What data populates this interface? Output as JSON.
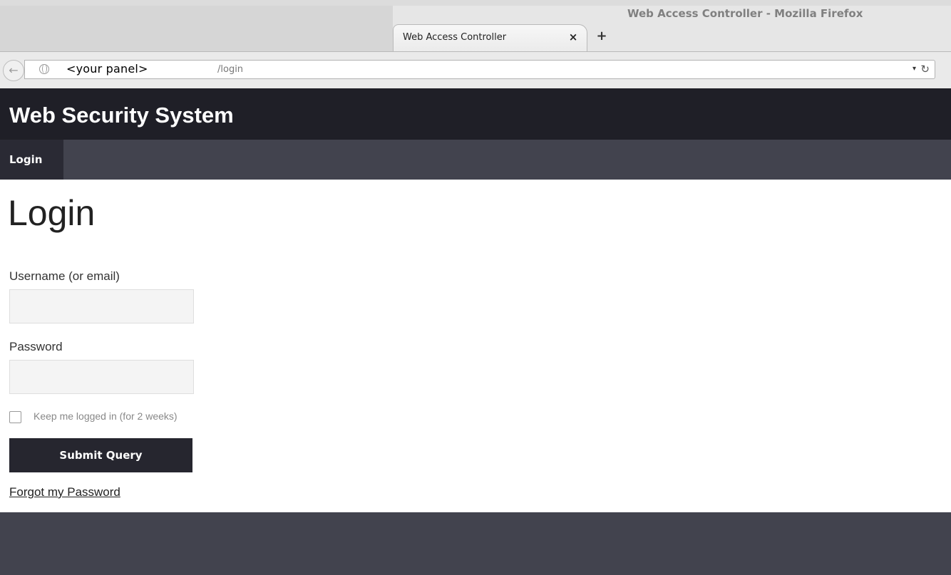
{
  "browser": {
    "window_title": "Web Access Controller - Mozilla Firefox",
    "tab_title": "Web Access Controller",
    "tab_close_icon": "×",
    "new_tab_icon": "+",
    "back_icon": "←",
    "url_host": "<your panel>",
    "url_path": "/login",
    "url_dropdown_icon": "▾",
    "reload_icon": "↻"
  },
  "site": {
    "title": "Web Security System",
    "nav": [
      {
        "label": "Login"
      }
    ]
  },
  "form": {
    "heading": "Login",
    "username_label": "Username (or email)",
    "username_value": "",
    "password_label": "Password",
    "password_value": "",
    "remember_label": "Keep me logged in (for 2 weeks)",
    "remember_checked": false,
    "submit_label": "Submit Query",
    "forgot_label": "Forgot my Password"
  },
  "colors": {
    "header_bg": "#1f1f27",
    "nav_bg": "#42434e",
    "nav_active_bg": "#2a2a34",
    "button_bg": "#26262f",
    "footer_bg": "#42434e"
  }
}
